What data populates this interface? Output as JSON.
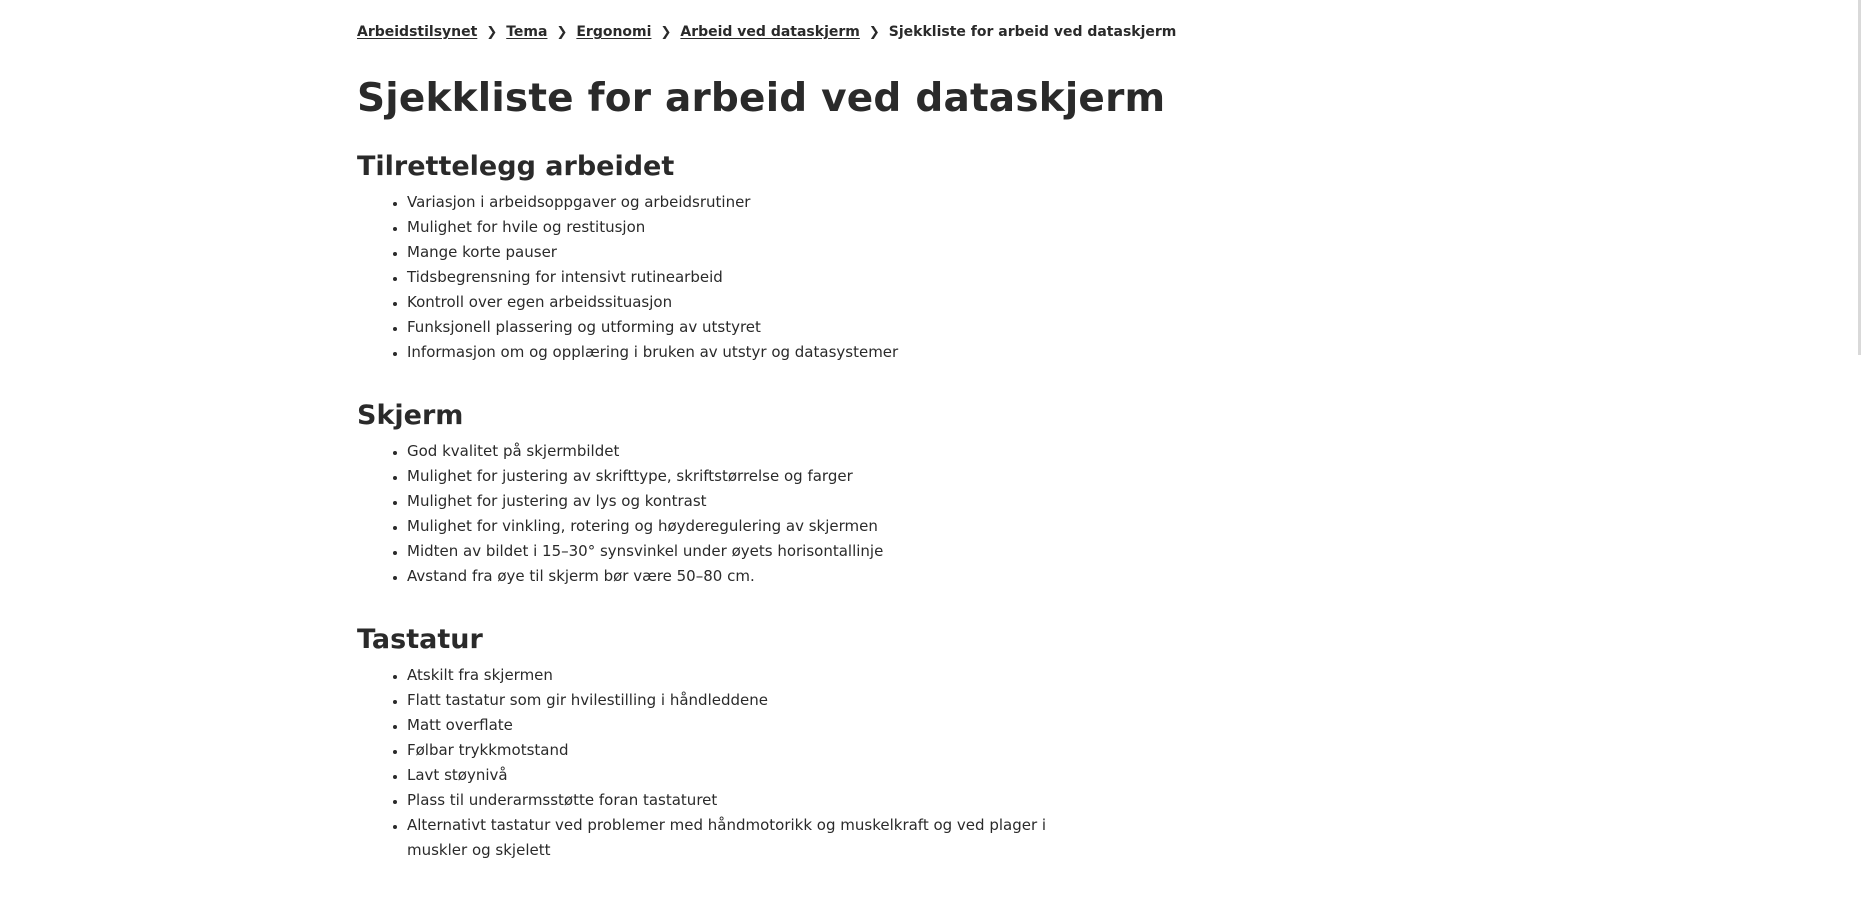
{
  "breadcrumb": {
    "items": [
      "Arbeidstilsynet",
      "Tema",
      "Ergonomi",
      "Arbeid ved dataskjerm"
    ],
    "current": "Sjekkliste for arbeid ved dataskjerm",
    "separator": "chevron-right-icon"
  },
  "page": {
    "title": "Sjekkliste for arbeid ved dataskjerm"
  },
  "sections": [
    {
      "heading": "Tilrettelegg arbeidet",
      "items": [
        "Variasjon i arbeidsoppgaver og arbeidsrutiner",
        "Mulighet for hvile og restitusjon",
        "Mange korte pauser",
        "Tidsbegrensning for intensivt rutinearbeid",
        "Kontroll over egen arbeidssituasjon",
        "Funksjonell plassering og utforming av utstyret",
        "Informasjon om og opplæring i bruken av utstyr og datasystemer"
      ]
    },
    {
      "heading": "Skjerm",
      "items": [
        "God kvalitet på skjermbildet",
        "Mulighet for justering av skrifttype, skriftstørrelse og farger",
        "Mulighet for justering av lys og kontrast",
        "Mulighet for vinkling, rotering og høyderegulering av skjermen",
        "Midten av bildet i 15–30° synsvinkel under øyets horisontallinje",
        "Avstand fra øye til skjerm bør være 50–80 cm."
      ]
    },
    {
      "heading": "Tastatur",
      "items": [
        "Atskilt fra skjermen",
        "Flatt tastatur som gir hvilestilling i håndleddene",
        "Matt overflate",
        "Følbar trykkmotstand",
        "Lavt støynivå",
        "Plass til underarmsstøtte foran tastaturet",
        "Alternativt tastatur ved problemer med håndmotorikk og muskelkraft og ved plager i muskler og skjelett"
      ]
    }
  ],
  "colors": {
    "text": "#2a2a2a",
    "background": "#ffffff"
  }
}
